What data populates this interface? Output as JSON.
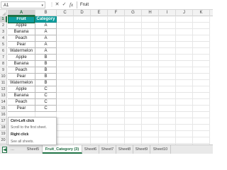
{
  "formula_bar": {
    "name_box": "A1",
    "dropdown_icon": "chevron-down-icon",
    "more_icon": "more-options-icon",
    "cancel_icon": "cancel-x-icon",
    "enter_icon": "checkmark-icon",
    "fx_label": "fx",
    "separator": "⋮",
    "content": "Fruit"
  },
  "grid": {
    "column_headers": [
      "A",
      "B",
      "C",
      "D",
      "E",
      "F",
      "G",
      "H",
      "I",
      "J",
      "K"
    ],
    "row_numbers": [
      "1",
      "2",
      "3",
      "4",
      "5",
      "6",
      "7",
      "8",
      "9",
      "10",
      "11",
      "12",
      "13",
      "14",
      "15",
      "16",
      "17",
      "18",
      "19",
      "20",
      "21"
    ],
    "table_headers": [
      "Fruit",
      "Category"
    ],
    "rows": [
      [
        "Apple",
        "A"
      ],
      [
        "Banana",
        "A"
      ],
      [
        "Peach",
        "A"
      ],
      [
        "Pear",
        "A"
      ],
      [
        "Watermelon",
        "A"
      ],
      [
        "Apple",
        "B"
      ],
      [
        "Banana",
        "B"
      ],
      [
        "Peach",
        "B"
      ],
      [
        "Pear",
        "B"
      ],
      [
        "Watermelon",
        "B"
      ],
      [
        "Apple",
        "C"
      ],
      [
        "Banana",
        "C"
      ],
      [
        "Peach",
        "C"
      ],
      [
        "Pear",
        "C"
      ]
    ],
    "header_fill": "#0e9e9e",
    "selection_color": "#217346"
  },
  "tooltip": {
    "line1": "Ctrl+Left click",
    "line2": "Scroll to the first sheet.",
    "line3": "Right click",
    "line4": "See all sheets."
  },
  "sheet_tabs": {
    "nav_prev": "◀",
    "nav_more": "...",
    "tabs": [
      "Sheet5",
      "Fruit_Category (3)",
      "Sheet6",
      "Sheet7",
      "Sheet8",
      "Sheet9",
      "Sheet10"
    ],
    "active_tab": "Fruit_Category (3)"
  }
}
